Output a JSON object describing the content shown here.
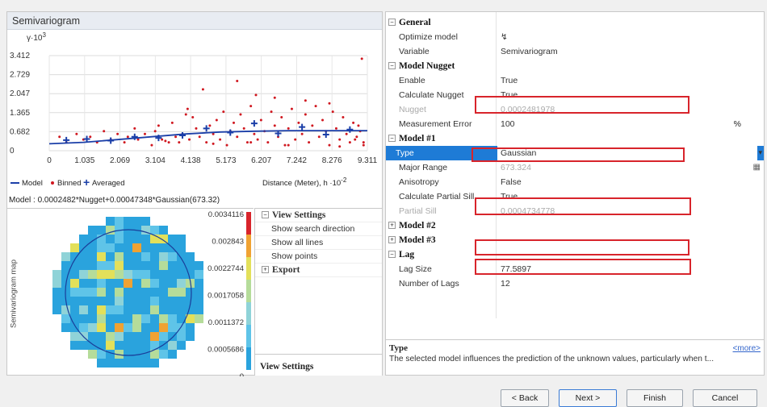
{
  "semivariogram": {
    "title": "Semivariogram",
    "y_axis_label": "γ·10",
    "y_axis_exp": "3",
    "x_axis_label": "Distance (Meter), h ·10",
    "x_axis_exp": "-2",
    "legend": {
      "model": "Model",
      "binned": "Binned",
      "averaged": "Averaged"
    },
    "model_formula": "Model : 0.0002482*Nugget+0.00047348*Gaussian(673.32)"
  },
  "chart_data": {
    "type": "scatter",
    "title": "Semivariogram",
    "ylabel": "γ·10^3",
    "xlabel": "Distance (Meter), h ·10^-2",
    "y_ticks": [
      "0",
      "0.682",
      "1.365",
      "2.047",
      "2.729",
      "3.412"
    ],
    "x_ticks": [
      "0",
      "1.035",
      "2.069",
      "3.104",
      "4.138",
      "5.173",
      "6.207",
      "7.242",
      "8.276",
      "9.311"
    ],
    "xlim": [
      0,
      9.311
    ],
    "ylim": [
      0,
      3.412
    ],
    "series": [
      {
        "name": "Model",
        "color": "#1b3fa8",
        "x": [
          0,
          1.0,
          2.0,
          3.0,
          4.0,
          5.0,
          6.0,
          7.0,
          8.0,
          9.311
        ],
        "y": [
          0.25,
          0.3,
          0.4,
          0.5,
          0.6,
          0.67,
          0.7,
          0.72,
          0.72,
          0.72
        ]
      },
      {
        "name": "Binned",
        "color": "#d01820",
        "x": [
          0.3,
          0.5,
          0.8,
          1.0,
          1.2,
          1.4,
          1.6,
          1.8,
          2.0,
          2.2,
          2.3,
          2.5,
          2.6,
          2.8,
          3.0,
          3.1,
          3.2,
          3.3,
          3.5,
          3.6,
          3.7,
          3.8,
          3.9,
          4.0,
          4.05,
          4.1,
          4.2,
          4.3,
          4.4,
          4.5,
          4.6,
          4.7,
          4.8,
          4.9,
          5.0,
          5.1,
          5.2,
          5.3,
          5.4,
          5.5,
          5.6,
          5.7,
          5.8,
          5.9,
          6.0,
          6.05,
          6.1,
          6.2,
          6.3,
          6.4,
          6.5,
          6.6,
          6.7,
          6.8,
          6.9,
          7.0,
          7.1,
          7.2,
          7.3,
          7.4,
          7.5,
          7.6,
          7.7,
          7.8,
          7.9,
          8.0,
          8.1,
          8.2,
          8.3,
          8.4,
          8.5,
          8.6,
          8.7,
          8.8,
          8.9,
          9.0,
          9.1,
          9.2,
          9.05,
          8.95,
          9.15,
          5.5,
          6.6,
          7.5,
          8.2,
          3.4,
          4.8,
          5.9,
          7.0,
          8.5,
          9.2
        ],
        "y": [
          0.5,
          0.3,
          0.6,
          0.4,
          0.5,
          0.3,
          0.7,
          0.4,
          0.6,
          0.3,
          0.5,
          0.8,
          0.4,
          0.6,
          0.2,
          0.7,
          0.9,
          0.4,
          0.3,
          1.0,
          0.5,
          0.3,
          0.6,
          1.3,
          1.5,
          0.4,
          1.2,
          0.8,
          0.5,
          2.2,
          0.3,
          0.9,
          0.6,
          1.1,
          0.4,
          1.4,
          0.2,
          0.7,
          1.0,
          0.5,
          1.3,
          0.8,
          0.3,
          1.6,
          0.6,
          2.0,
          0.4,
          1.1,
          0.7,
          0.3,
          1.4,
          0.9,
          0.5,
          1.2,
          0.2,
          0.8,
          1.5,
          0.4,
          1.0,
          0.6,
          1.3,
          0.3,
          0.9,
          1.6,
          0.5,
          1.1,
          0.7,
          0.2,
          1.4,
          0.8,
          0.4,
          1.2,
          0.6,
          0.3,
          1.0,
          0.5,
          0.7,
          0.2,
          0.9,
          0.4,
          3.3,
          2.5,
          1.9,
          1.8,
          1.7,
          0.35,
          0.25,
          0.3,
          0.2,
          0.15,
          0.3
        ]
      },
      {
        "name": "Averaged",
        "color": "#1b3fa8",
        "x": [
          0.5,
          1.1,
          1.8,
          2.5,
          3.2,
          3.9,
          4.6,
          5.3,
          6.0,
          6.7,
          7.4,
          8.1,
          8.8
        ],
        "y": [
          0.38,
          0.42,
          0.36,
          0.5,
          0.46,
          0.55,
          0.8,
          0.65,
          0.98,
          0.62,
          0.85,
          0.58,
          0.76
        ]
      }
    ]
  },
  "map": {
    "vlabel": "Semivariogram map",
    "legend_ticks": [
      "0.0034116",
      "0.002843",
      "0.0022744",
      "0.0017058",
      "0.0011372",
      "0.0005686",
      "0"
    ],
    "colors": [
      "#2aa3dd",
      "#2aa3dd",
      "#2aa3dd",
      "#5fc4e8",
      "#8fd3d8",
      "#b5dc9a",
      "#e3e05a",
      "#f0a232"
    ]
  },
  "view_settings": {
    "category": "View Settings",
    "items": [
      "Show search direction",
      "Show all lines",
      "Show points"
    ],
    "export": "Export",
    "footer": "View Settings"
  },
  "properties": {
    "general": "General",
    "optimize_label": "Optimize model",
    "optimize_value": "",
    "variable_label": "Variable",
    "variable_value": "Semivariogram",
    "model_nugget": "Model Nugget",
    "enable_label": "Enable",
    "enable_value": "True",
    "calc_nugget_label": "Calculate Nugget",
    "calc_nugget_value": "True",
    "nugget_label": "Nugget",
    "nugget_value": "0.0002481978",
    "measurement_error_label": "Measurement Error",
    "measurement_error_value": "100",
    "percent": "%",
    "model1": "Model #1",
    "type_label": "Type",
    "type_value": "Gaussian",
    "major_range_label": "Major Range",
    "major_range_value": "673.324",
    "anisotropy_label": "Anisotropy",
    "anisotropy_value": "False",
    "calc_partial_sill_label": "Calculate Partial Sill",
    "calc_partial_sill_value": "True",
    "partial_sill_label": "Partial Sill",
    "partial_sill_value": "0.0004734778",
    "model2": "Model #2",
    "model3": "Model #3",
    "lag": "Lag",
    "lag_size_label": "Lag Size",
    "lag_size_value": "77.5897",
    "num_lags_label": "Number of Lags",
    "num_lags_value": "12"
  },
  "description": {
    "title": "Type",
    "text": "The selected model influences the prediction of the unknown values, particularly when t...",
    "more": "<more>"
  },
  "buttons": {
    "back": "< Back",
    "next": "Next >",
    "finish": "Finish",
    "cancel": "Cancel"
  }
}
